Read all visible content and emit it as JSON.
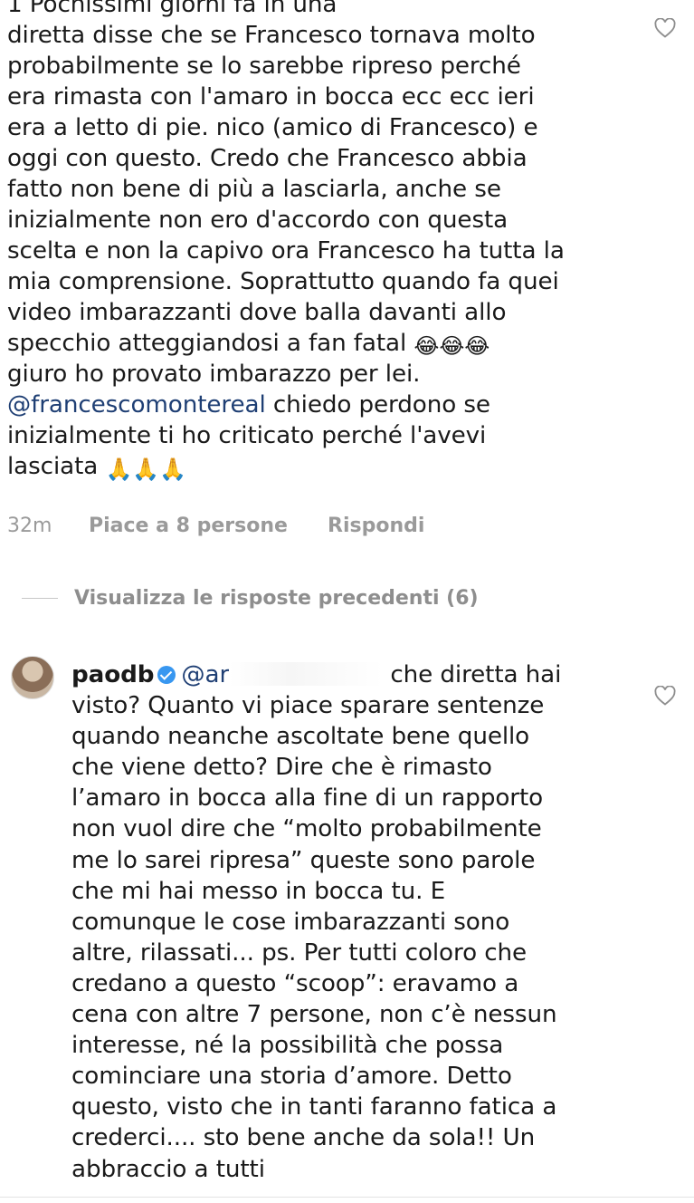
{
  "comment1": {
    "text_line1": "1 Pochissimi giorni fa in una",
    "text_body": "diretta disse che se Francesco tornava molto\nprobabilmente se lo sarebbe ripreso perché\nera rimasta con l'amaro in bocca ecc ecc ieri\nera a letto di pie. nico (amico di Francesco) e\noggi con questo. Credo che Francesco abbia\nfatto non bene di più a lasciarla, anche se\ninizialmente non ero d'accordo con questa\nscelta e non la capivo ora Francesco ha tutta la\nmia comprensione. Soprattutto quando fa quei\nvideo imbarazzanti dove balla davanti allo\nspecchio atteggiandosi a fan fatal",
    "laugh_emojis": "😂😂😂",
    "text_after": "giuro ho provato imbarazzo per lei.",
    "mention": "@francescomontereal",
    "text_tail": " chiedo perdono se\ninizialmente ti ho criticato perché l'avevi\nlasciata",
    "pray_emojis": "🙏🙏🙏",
    "time": "32m",
    "likes": "Piace a 8 persone",
    "reply": "Rispondi"
  },
  "view_replies": "Visualizza le risposte precedenti (6)",
  "comment2": {
    "username": "paodb",
    "mention_prefix": "@ar",
    "text_first": "che diretta hai",
    "text_body": "visto? Quanto vi piace sparare sentenze\nquando neanche ascoltate bene quello\nche viene detto? Dire che è rimasto\nl’amaro in bocca alla fine di un rapporto\nnon vuol dire che “molto probabilmente\nme lo sarei ripresa” queste sono parole\nche mi hai messo in bocca tu. E\ncomunque le cose imbarazzanti sono\naltre, rilassati... ps. Per tutti coloro che\ncredano a questo “scoop”: eravamo a\ncena con altre 7 persone, non c’è nessun\ninteresse, né la possibilità che possa\ncominciare una storia d’amore. Detto\nquesto, visto che in tanti faranno fatica a\ncrederci.... sto bene anche da sola!! Un\nabbraccio a tutti"
  },
  "icons": {
    "like": "heart-icon",
    "verified": "verified-badge-icon",
    "avatar": "avatar"
  }
}
